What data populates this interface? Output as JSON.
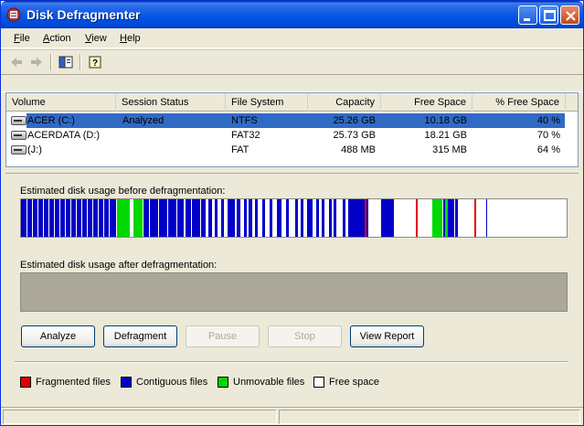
{
  "window": {
    "title": "Disk Defragmenter",
    "icon": "disk-defrag-app-icon",
    "controls": [
      "minimize-icon",
      "maximize-icon",
      "close-icon"
    ]
  },
  "menu": {
    "file": {
      "u": "F",
      "rest": "ile"
    },
    "action": {
      "u": "A",
      "rest": "ction"
    },
    "view": {
      "u": "V",
      "rest": "iew"
    },
    "help": {
      "u": "H",
      "rest": "elp"
    }
  },
  "toolbar": {
    "icons": [
      "back-arrow-icon",
      "forward-arrow-icon",
      "show-hide-console-tree-icon",
      "help-icon"
    ]
  },
  "volumes": {
    "columns": [
      "Volume",
      "Session Status",
      "File System",
      "Capacity",
      "Free Space",
      "% Free Space"
    ],
    "rows": [
      {
        "volume": "ACER (C:)",
        "status": "Analyzed",
        "fs": "NTFS",
        "capacity": "25.26 GB",
        "free": "10.18 GB",
        "pct": "40 %",
        "selected": true
      },
      {
        "volume": "ACERDATA (D:)",
        "status": "",
        "fs": "FAT32",
        "capacity": "25.73 GB",
        "free": "18.21 GB",
        "pct": "70 %",
        "selected": false
      },
      {
        "volume": "(J:)",
        "status": "",
        "fs": "FAT",
        "capacity": "488 MB",
        "free": "315 MB",
        "pct": "64 %",
        "selected": false
      }
    ]
  },
  "analysis": {
    "before_label": "Estimated disk usage before defragmentation:",
    "after_label": "Estimated disk usage after defragmentation:"
  },
  "buttons": {
    "analyze": "Analyze",
    "defragment": "Defragment",
    "pause": "Pause",
    "stop": "Stop",
    "view_report": "View Report"
  },
  "legend": {
    "fragmented": "Fragmented files",
    "contiguous": "Contiguous files",
    "unmovable": "Unmovable files",
    "free": "Free space"
  },
  "colors": {
    "fragmented": "#e00000",
    "contiguous": "#0000c8",
    "unmovable": "#00d800",
    "free": "#ffffff",
    "selection": "#316ac5"
  }
}
